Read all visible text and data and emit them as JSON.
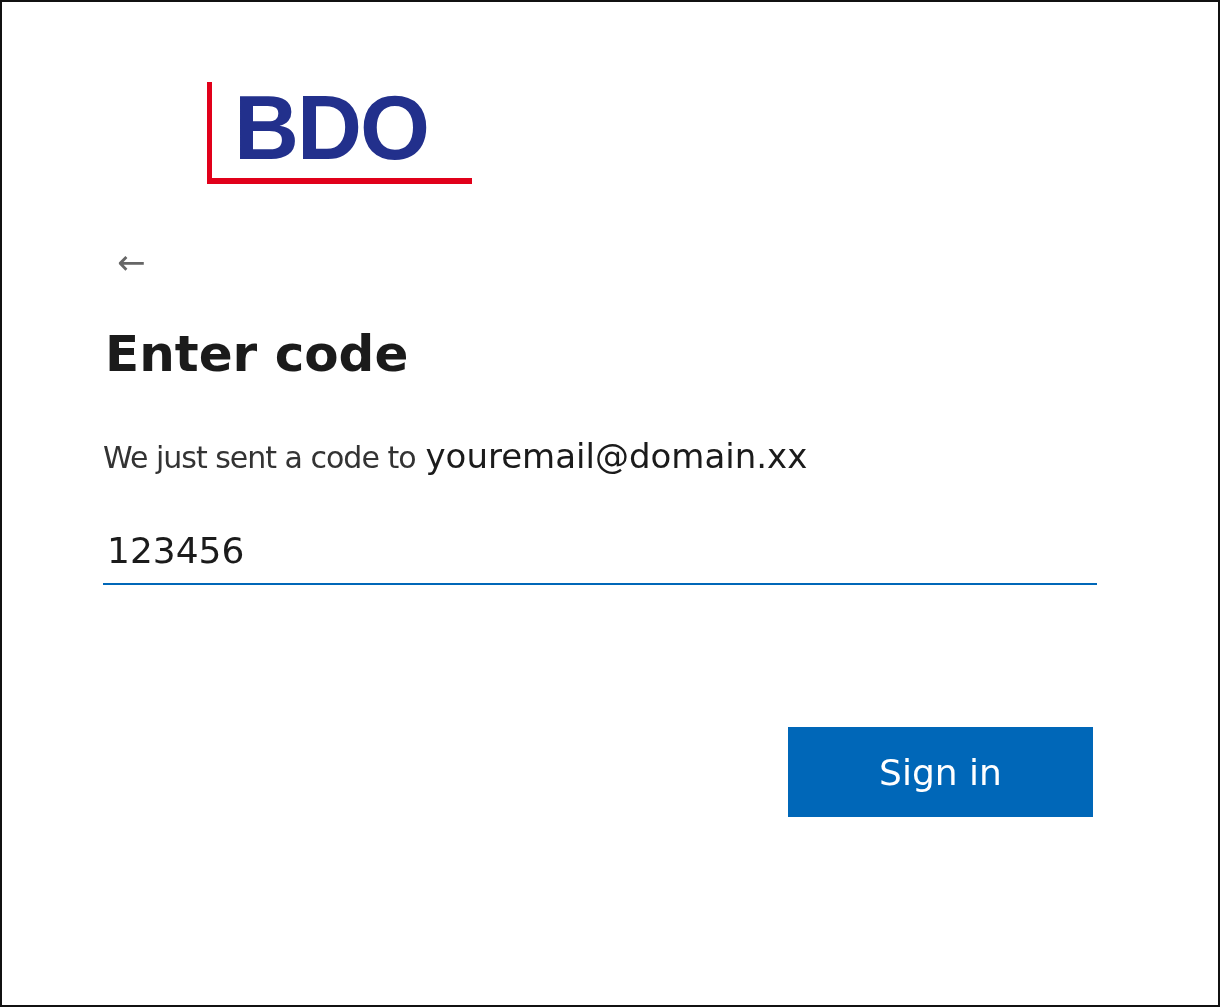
{
  "logo": {
    "text": "BDO"
  },
  "back": {
    "icon": "←"
  },
  "title": "Enter code",
  "message": {
    "text": "We just sent a code to",
    "email": "youremail@domain.xx"
  },
  "code_field": {
    "value": "123456",
    "focused": true
  },
  "buttons": [
    {
      "label": "Sign in",
      "kind": "primary"
    }
  ]
}
